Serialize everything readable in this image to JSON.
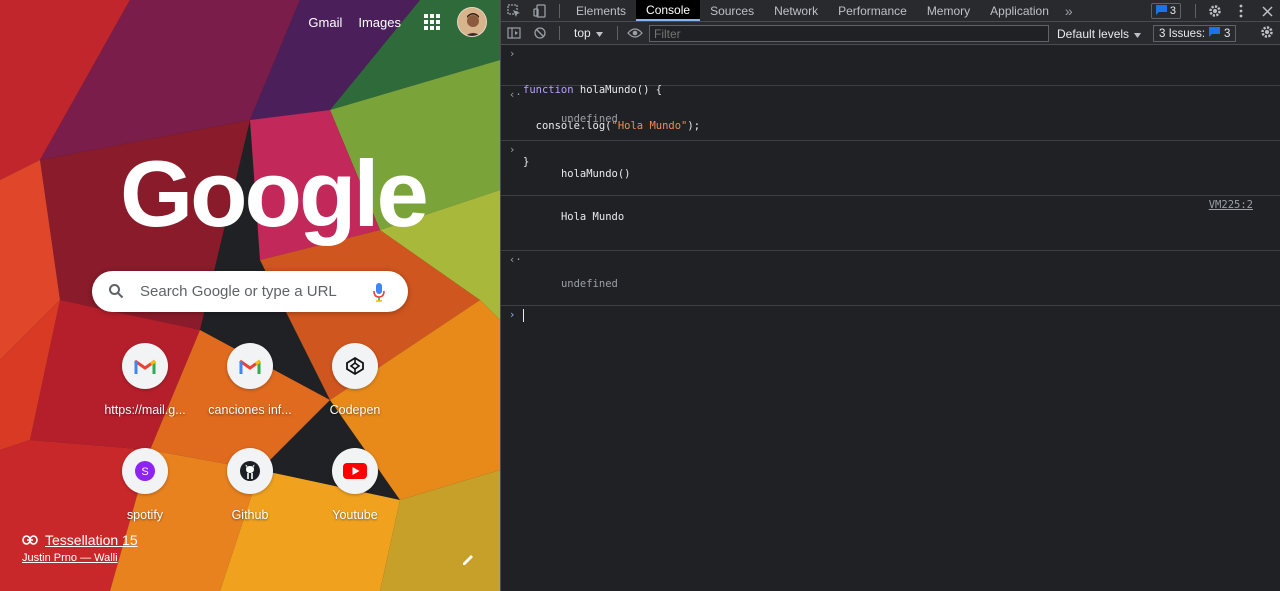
{
  "ntp": {
    "links": {
      "gmail": "Gmail",
      "images": "Images"
    },
    "logo_text": "Google",
    "search_placeholder": "Search Google or type a URL",
    "shortcuts": [
      {
        "label": "https://mail.g...",
        "icon": "gmail-icon"
      },
      {
        "label": "canciones inf...",
        "icon": "gmail-icon"
      },
      {
        "label": "Codepen",
        "icon": "codepen-icon"
      },
      {
        "label": "spotify",
        "icon": "letter-s-icon",
        "letter": "S"
      },
      {
        "label": "Github",
        "icon": "github-icon"
      },
      {
        "label": "Youtube",
        "icon": "youtube-icon"
      }
    ],
    "attribution": {
      "title": "Tessellation 15",
      "author": "Justin Prno — Walli"
    }
  },
  "devtools": {
    "tabs": [
      "Elements",
      "Console",
      "Sources",
      "Network",
      "Performance",
      "Memory",
      "Application"
    ],
    "active_tab": "Console",
    "issue_badge_count": "3",
    "toolbar": {
      "context": "top",
      "filter_placeholder": "Filter",
      "levels": "Default levels",
      "issues_label": "3 Issues:",
      "issues_count": "3"
    },
    "console": {
      "entry1": {
        "l1_kw": "function",
        "l1_rest": " holaMundo() {",
        "l2_pre": "  console.log(",
        "l2_str": "\"Hola Mundo\"",
        "l2_post": ");",
        "l3": "}"
      },
      "result1": "undefined",
      "entry2": "holaMundo()",
      "log_text": "Hola Mundo",
      "log_source": "VM225:2",
      "result2": "undefined"
    }
  },
  "colors": {
    "accent": "#8ab4f8",
    "devtools_bg": "#202124",
    "active_tab_bg": "#000000"
  }
}
